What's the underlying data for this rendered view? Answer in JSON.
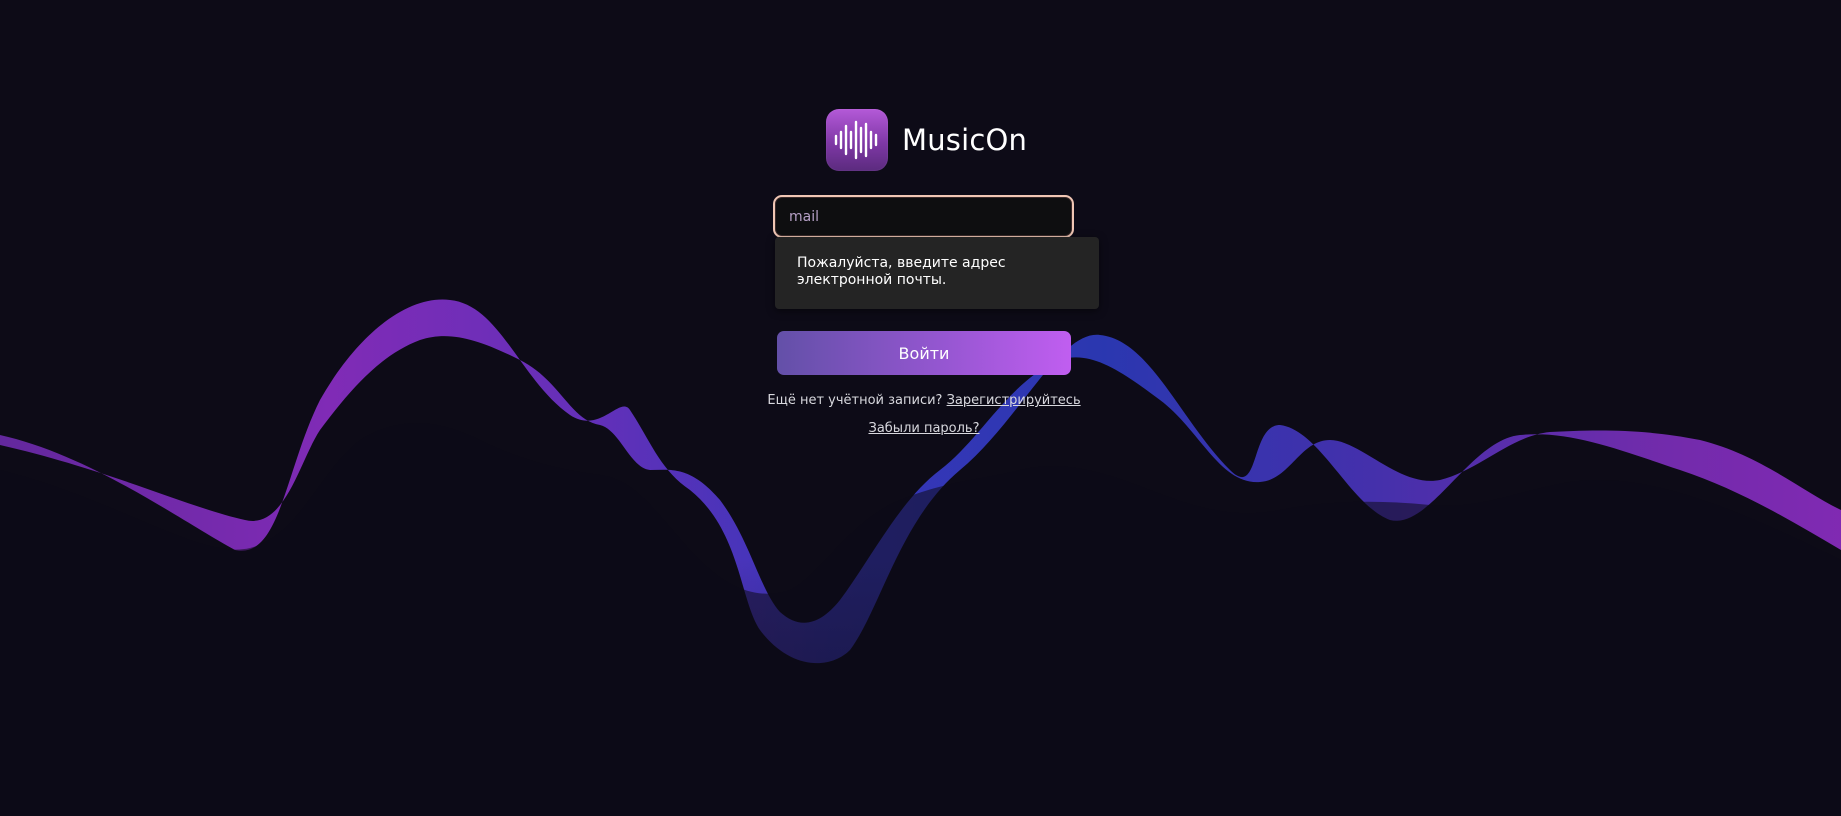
{
  "brand": {
    "name": "MusicOn",
    "icon": "waveform-icon"
  },
  "login_form": {
    "email_placeholder": "mail",
    "email_value": "",
    "validation_message": "Пожалуйста, введите адрес электронной почты.",
    "submit_label": "Войти"
  },
  "footer_links": {
    "no_account_text": "Ещё нет учётной записи?",
    "register_link": "Зарегистрируйтесь",
    "forgot_password_link": "Забыли пароль?"
  },
  "colors": {
    "background": "#0d0b17",
    "accent_purple": "#a646d8",
    "accent_blue": "#3b3fc9",
    "button_gradient_start": "#6350a8",
    "button_gradient_end": "#c05ef0"
  }
}
